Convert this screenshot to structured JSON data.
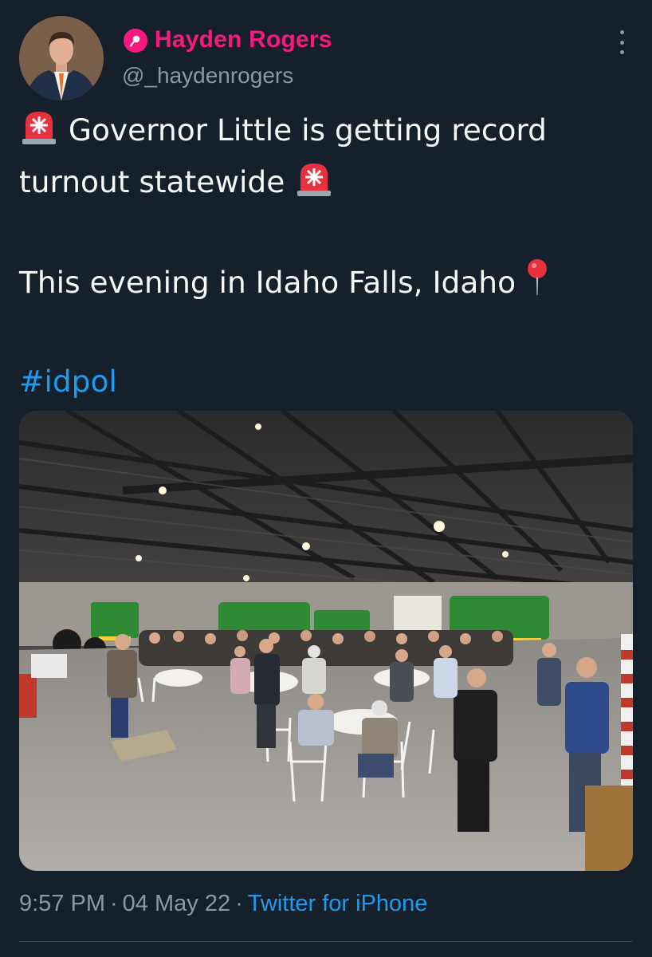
{
  "author": {
    "name": "Hayden Rogers",
    "handle": "@_haydenrogers",
    "badge_icon": "verified-pin-icon",
    "name_color": "#f91880"
  },
  "tweet": {
    "line1_text": "Governor Little is getting record",
    "line2_text": "turnout statewide",
    "line3_text": "This evening in Idaho Falls, Idaho",
    "hashtag": "#idpol",
    "emoji_line1": "rotating-light-icon",
    "emoji_line2": "rotating-light-icon",
    "emoji_line3": "round-pushpin-icon"
  },
  "meta": {
    "time": "9:57 PM",
    "separator": "·",
    "date": "04 May 22",
    "source": "Twitter for iPhone"
  },
  "colors": {
    "background": "#15202b",
    "text": "#f7f9f9",
    "muted": "#8b98a5",
    "link": "#1d9bf0"
  }
}
